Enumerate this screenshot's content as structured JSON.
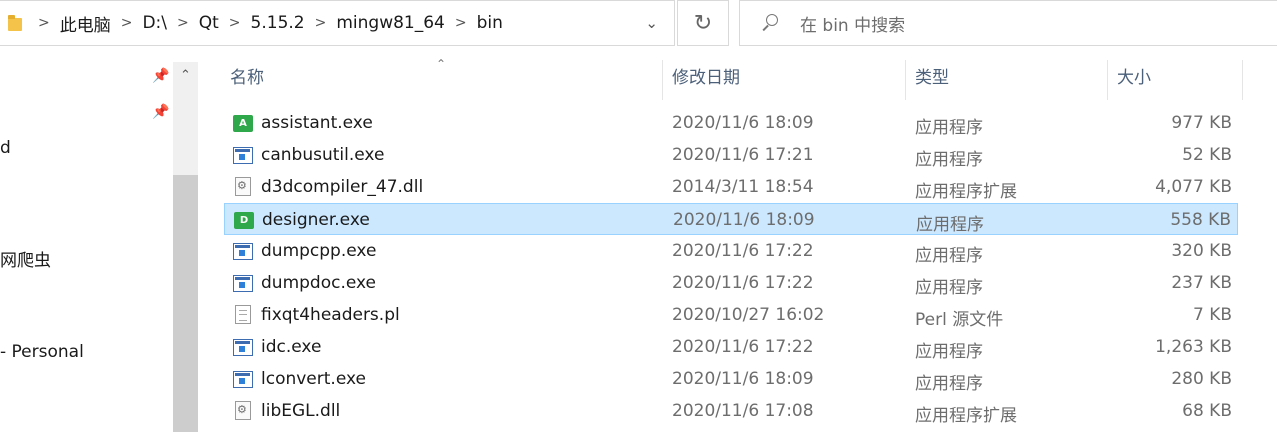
{
  "address_bar": {
    "crumbs": [
      "此电脑",
      "D:\\",
      "Qt",
      "5.15.2",
      "mingw81_64",
      "bin"
    ]
  },
  "search": {
    "placeholder": "在 bin 中搜索"
  },
  "nav": {
    "items": [
      "d",
      "网爬虫",
      "- Personal"
    ]
  },
  "columns": {
    "name": "名称",
    "date": "修改日期",
    "type": "类型",
    "size": "大小"
  },
  "files": [
    {
      "name": "assistant.exe",
      "date": "2020/11/6 18:09",
      "type": "应用程序",
      "size": "977 KB",
      "icon": "app-green-icon",
      "letter": "A"
    },
    {
      "name": "canbusutil.exe",
      "date": "2020/11/6 17:21",
      "type": "应用程序",
      "size": "52 KB",
      "icon": "exe-icon"
    },
    {
      "name": "d3dcompiler_47.dll",
      "date": "2014/3/11 18:54",
      "type": "应用程序扩展",
      "size": "4,077 KB",
      "icon": "dll-icon"
    },
    {
      "name": "designer.exe",
      "date": "2020/11/6 18:09",
      "type": "应用程序",
      "size": "558 KB",
      "icon": "app-green-icon",
      "letter": "D",
      "selected": true
    },
    {
      "name": "dumpcpp.exe",
      "date": "2020/11/6 17:22",
      "type": "应用程序",
      "size": "320 KB",
      "icon": "exe-icon"
    },
    {
      "name": "dumpdoc.exe",
      "date": "2020/11/6 17:22",
      "type": "应用程序",
      "size": "237 KB",
      "icon": "exe-icon"
    },
    {
      "name": "fixqt4headers.pl",
      "date": "2020/10/27 16:02",
      "type": "Perl 源文件",
      "size": "7 KB",
      "icon": "document-icon"
    },
    {
      "name": "idc.exe",
      "date": "2020/11/6 17:22",
      "type": "应用程序",
      "size": "1,263 KB",
      "icon": "exe-icon"
    },
    {
      "name": "lconvert.exe",
      "date": "2020/11/6 18:09",
      "type": "应用程序",
      "size": "280 KB",
      "icon": "exe-icon"
    },
    {
      "name": "libEGL.dll",
      "date": "2020/11/6 17:08",
      "type": "应用程序扩展",
      "size": "68 KB",
      "icon": "dll-icon"
    }
  ]
}
